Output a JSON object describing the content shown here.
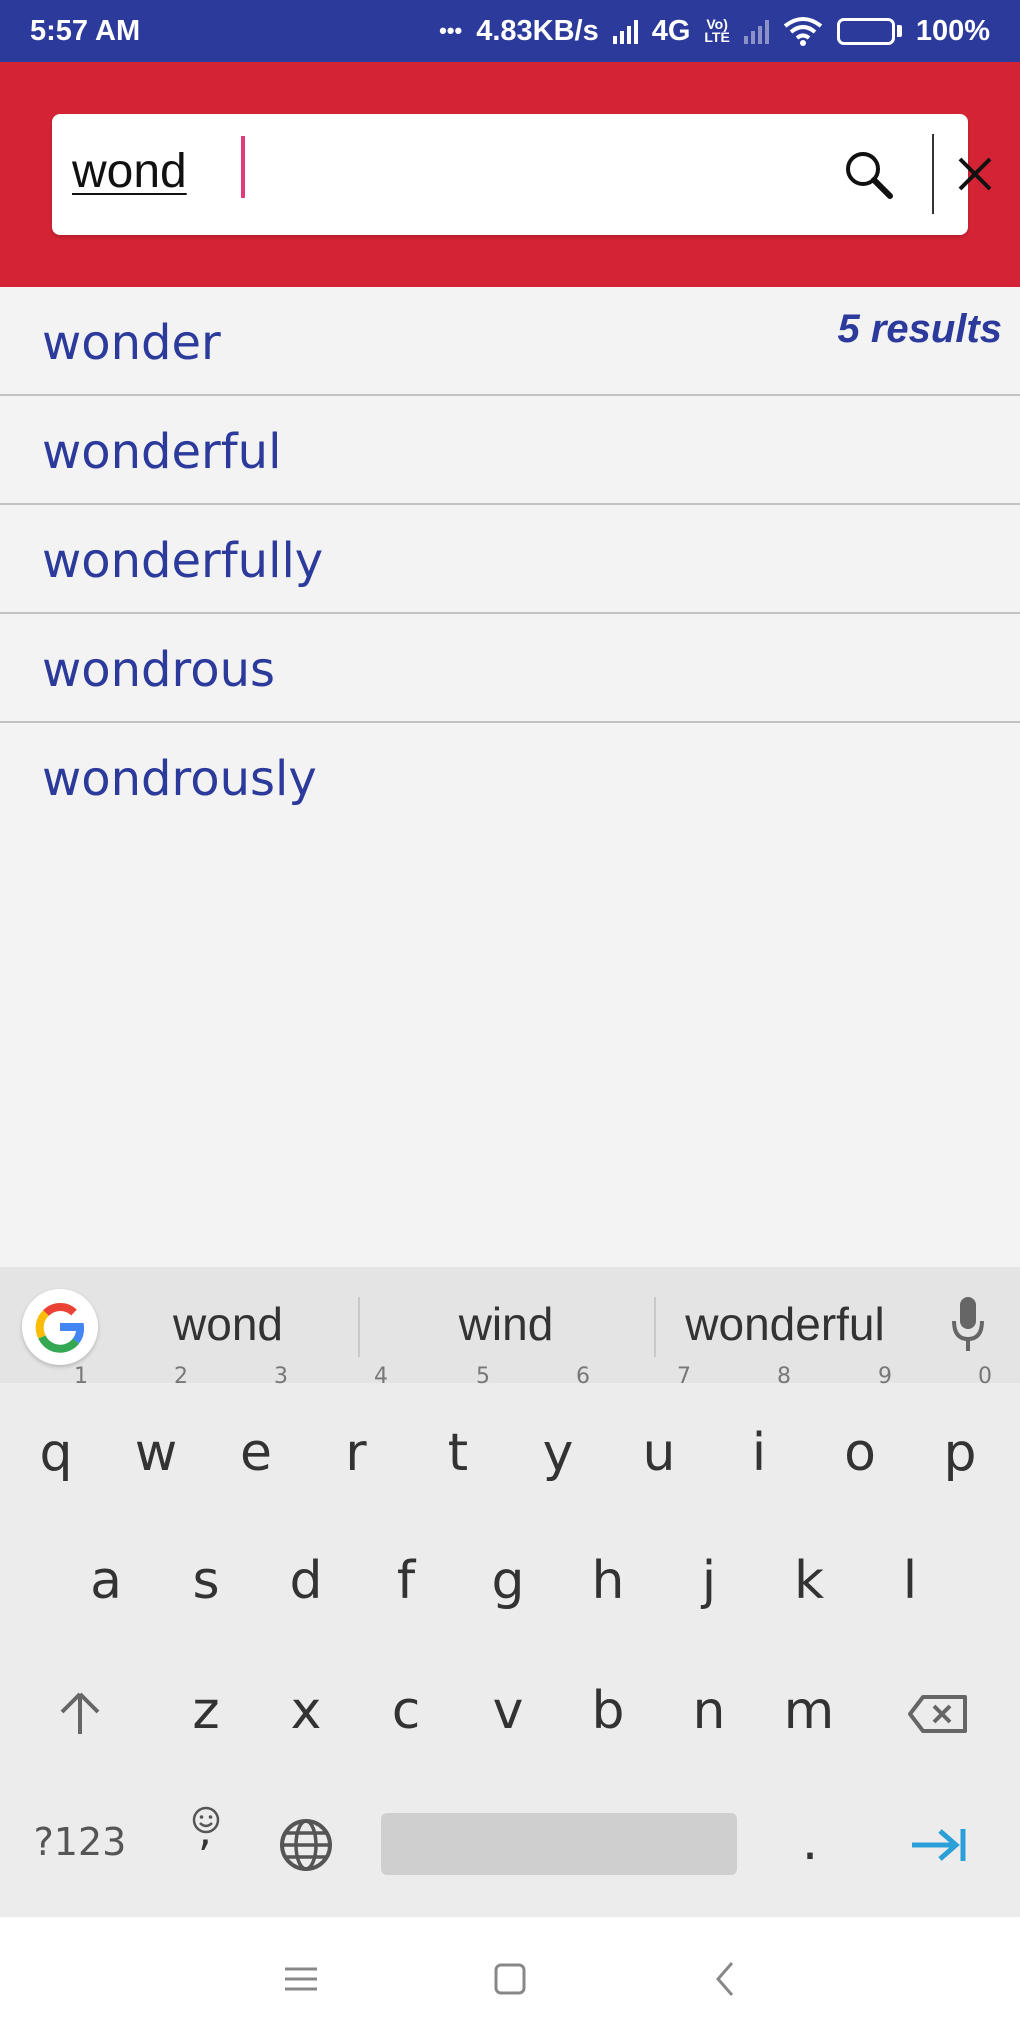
{
  "status_bar": {
    "time": "5:57 AM",
    "dots": "•••",
    "speed": "4.83KB/s",
    "network": "4G",
    "volte_top": "Vo)",
    "volte_bottom": "LTE",
    "battery": "100%"
  },
  "search": {
    "query": "wond"
  },
  "results": {
    "count_label": "5 results",
    "items": [
      "wonder",
      "wonderful",
      "wonderfully",
      "wondrous",
      "wondrously"
    ]
  },
  "keyboard": {
    "suggestions": [
      "wond",
      "wind",
      "wonderful"
    ],
    "row1": [
      "q",
      "w",
      "e",
      "r",
      "t",
      "y",
      "u",
      "i",
      "o",
      "p"
    ],
    "row1_hints": [
      "1",
      "2",
      "3",
      "4",
      "5",
      "6",
      "7",
      "8",
      "9",
      "0"
    ],
    "row2": [
      "a",
      "s",
      "d",
      "f",
      "g",
      "h",
      "j",
      "k",
      "l"
    ],
    "row3": [
      "z",
      "x",
      "c",
      "v",
      "b",
      "n",
      "m"
    ],
    "symbols_label": "?123",
    "period": ".",
    "comma": ","
  },
  "colors": {
    "status_bar": "#2b3a9b",
    "header": "#d32334",
    "result_text": "#2b3a9b",
    "caret": "#e23a7c",
    "enter_key": "#2a9fd8"
  },
  "icons": {
    "search": "magnifier-icon",
    "clear": "close-icon",
    "mic": "mic-icon",
    "shift": "shift-arrow-icon",
    "backspace": "backspace-icon",
    "globe": "globe-icon",
    "emoji": "emoji-icon",
    "enter": "tab-enter-icon",
    "nav_menu": "menu-icon",
    "nav_home": "home-square-icon",
    "nav_back": "back-chevron-icon"
  }
}
